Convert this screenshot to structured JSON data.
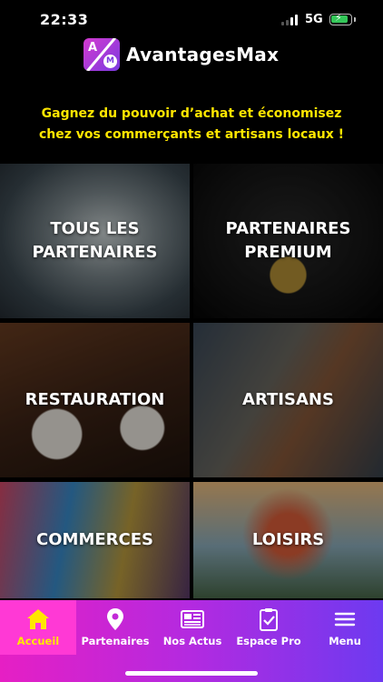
{
  "status": {
    "time": "22:33",
    "network": "5G"
  },
  "brand": {
    "name": "AvantagesMax",
    "logo_letters": [
      "A",
      "M"
    ]
  },
  "tagline": "Gagnez du pouvoir d’achat et économisez\nchez vos commerçants et artisans locaux !",
  "tiles": [
    {
      "label": "TOUS LES\nPARTENAIRES",
      "image": "tablet-map-photo"
    },
    {
      "label": "PARTENAIRES\nPREMIUM",
      "image": "gold-medal-photo"
    },
    {
      "label": "RESTAURATION",
      "image": "restaurant-table-photo"
    },
    {
      "label": "ARTISANS",
      "image": "tools-photo"
    },
    {
      "label": "COMMERCES",
      "image": "colorful-street-photo"
    },
    {
      "label": "LOISIRS",
      "image": "ferris-wheel-photo"
    }
  ],
  "tabs": [
    {
      "label": "Accueil",
      "icon": "home-icon",
      "active": true
    },
    {
      "label": "Partenaires",
      "icon": "map-pin-icon",
      "active": false
    },
    {
      "label": "Nos Actus",
      "icon": "newspaper-icon",
      "active": false
    },
    {
      "label": "Espace Pro",
      "icon": "clipboard-check-icon",
      "active": false
    },
    {
      "label": "Menu",
      "icon": "hamburger-icon",
      "active": false
    }
  ],
  "colors": {
    "tagline": "#ffe600",
    "tabbar_start": "#e61fc4",
    "tabbar_end": "#6d3af0",
    "tab_active_bg": "#ff39d5",
    "tab_active_label": "#ffe600",
    "battery": "#34c759"
  }
}
